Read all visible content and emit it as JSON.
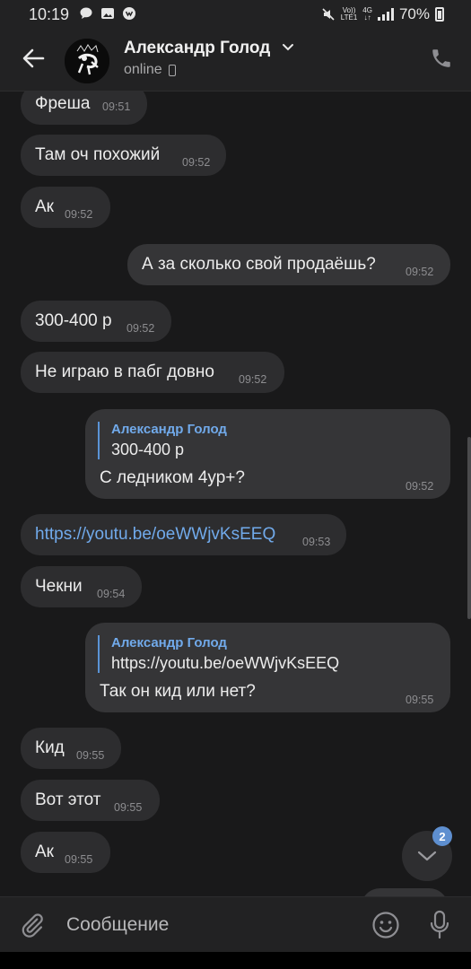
{
  "status_bar": {
    "time": "10:19",
    "volte_top": "Vo))",
    "volte_bottom": "LTE1",
    "net_top": "4G",
    "net_bottom": "↓↑",
    "battery": "70%"
  },
  "header": {
    "contact_name": "Александр Голод",
    "status": "online"
  },
  "messages": [
    {
      "text": "Фреша",
      "time": "09:51",
      "dir": "in"
    },
    {
      "text": "Там оч похожий",
      "time": "09:52",
      "dir": "in"
    },
    {
      "text": "Ак",
      "time": "09:52",
      "dir": "in"
    },
    {
      "text": "А за сколько свой продаёшь?",
      "time": "09:52",
      "dir": "out"
    },
    {
      "text": "300-400 р",
      "time": "09:52",
      "dir": "in"
    },
    {
      "text": "Не играю в пабг довно",
      "time": "09:52",
      "dir": "in"
    },
    {
      "quote_author": "Александр Голод",
      "quote_text": "300-400 р",
      "text": "С ледником 4ур+?",
      "time": "09:52",
      "dir": "out"
    },
    {
      "text": "https://youtu.be/oeWWjvKsEEQ",
      "time": "09:53",
      "dir": "in",
      "is_link": true
    },
    {
      "text": "Чекни",
      "time": "09:54",
      "dir": "in"
    },
    {
      "quote_author": "Александр Голод",
      "quote_text": "https://youtu.be/oeWWjvKsEEQ",
      "text": "Так он кид или нет?",
      "time": "09:55",
      "dir": "out"
    },
    {
      "text": "Кид",
      "time": "09:55",
      "dir": "in"
    },
    {
      "text": "Вот этот",
      "time": "09:55",
      "dir": "in"
    },
    {
      "text": "Ак",
      "time": "09:55",
      "dir": "in"
    }
  ],
  "scroll_button": {
    "badge": "2"
  },
  "composer": {
    "placeholder": "Сообщение"
  },
  "colors": {
    "background": "#19191a",
    "bubble_in": "#2d2d2f",
    "bubble_out": "#353537",
    "accent": "#71aaeb"
  }
}
